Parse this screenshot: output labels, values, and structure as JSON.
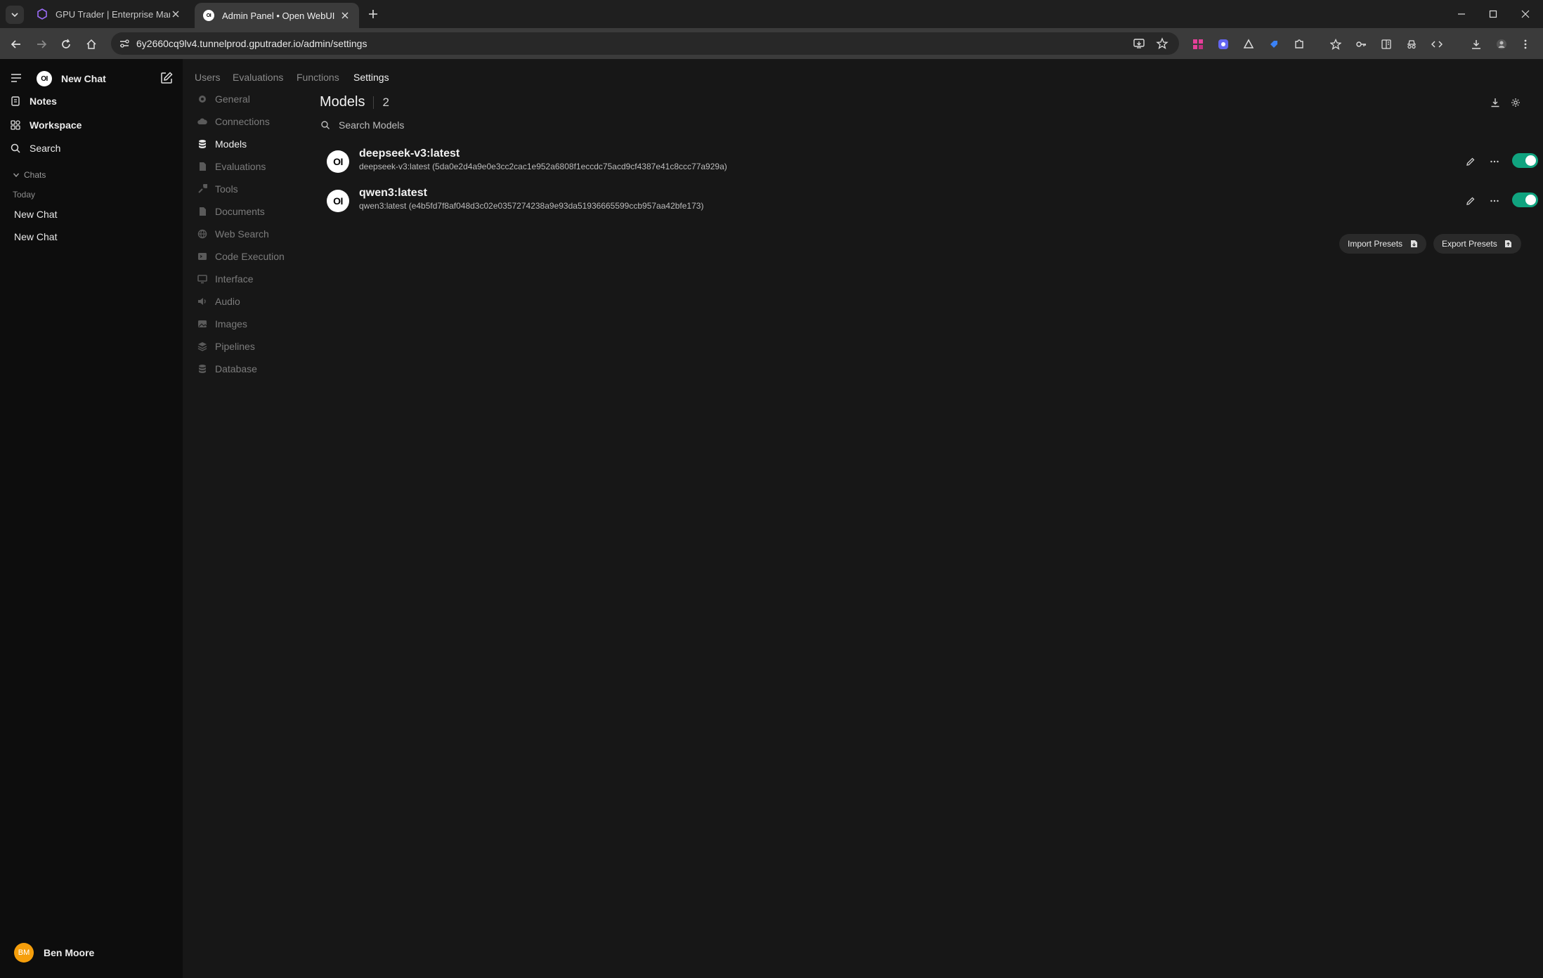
{
  "browser": {
    "tabs": [
      {
        "title": "GPU Trader | Enterprise Marketplace",
        "active": false
      },
      {
        "title": "Admin Panel • Open WebUI",
        "active": true
      }
    ],
    "url": "6y2660cq9lv4.tunnelprod.gputrader.io/admin/settings"
  },
  "sidebar": {
    "logo_text": "OI",
    "new_chat": "New Chat",
    "items": [
      {
        "label": "Notes",
        "icon": "notes-icon"
      },
      {
        "label": "Workspace",
        "icon": "workspace-icon"
      },
      {
        "label": "Search",
        "icon": "search-icon"
      }
    ],
    "section": "Chats",
    "group": "Today",
    "chats": [
      "New Chat",
      "New Chat"
    ],
    "user": {
      "initials": "BM",
      "name": "Ben Moore",
      "avatar_color": "#f59e0b"
    }
  },
  "admin": {
    "tabs": [
      "Users",
      "Evaluations",
      "Functions",
      "Settings"
    ],
    "active_tab": "Settings",
    "settings_nav": [
      {
        "label": "General",
        "icon": "gear-icon"
      },
      {
        "label": "Connections",
        "icon": "cloud-icon"
      },
      {
        "label": "Models",
        "icon": "database-icon",
        "active": true
      },
      {
        "label": "Evaluations",
        "icon": "document-icon"
      },
      {
        "label": "Tools",
        "icon": "wrench-icon"
      },
      {
        "label": "Documents",
        "icon": "document-icon"
      },
      {
        "label": "Web Search",
        "icon": "globe-icon"
      },
      {
        "label": "Code Execution",
        "icon": "terminal-icon"
      },
      {
        "label": "Interface",
        "icon": "monitor-icon"
      },
      {
        "label": "Audio",
        "icon": "speaker-icon"
      },
      {
        "label": "Images",
        "icon": "image-icon"
      },
      {
        "label": "Pipelines",
        "icon": "layers-icon"
      },
      {
        "label": "Database",
        "icon": "database-icon"
      }
    ]
  },
  "models_panel": {
    "title": "Models",
    "count": "2",
    "search_placeholder": "Search Models",
    "models": [
      {
        "name": "deepseek-v3:latest",
        "id": "deepseek-v3:latest (5da0e2d4a9e0e3cc2cac1e952a6808f1eccdc75acd9cf4387e41c8ccc77a929a)",
        "enabled": true
      },
      {
        "name": "qwen3:latest",
        "id": "qwen3:latest (e4b5fd7f8af048d3c02e0357274238a9e93da51936665599ccb957aa42bfe173)",
        "enabled": true
      }
    ],
    "import_label": "Import Presets",
    "export_label": "Export Presets"
  },
  "colors": {
    "toggle_on": "#10a37f",
    "accent_avatar": "#f59e0b"
  }
}
